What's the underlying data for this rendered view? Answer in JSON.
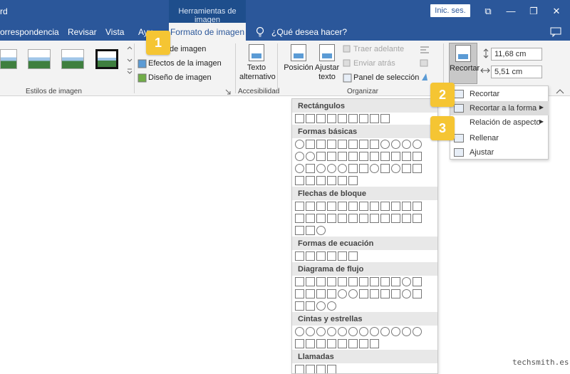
{
  "titlebar": {
    "app_fragment": "rd",
    "context_tab": "Herramientas de imagen",
    "signin": "Inic. ses.",
    "restore_glyph": "⧉",
    "minimize_glyph": "—",
    "maximize_glyph": "❐",
    "close_glyph": "✕"
  },
  "tabs": {
    "correspondencia": "orrespondencia",
    "revisar": "Revisar",
    "vista": "Vista",
    "ayuda": "Ayu",
    "formato": "Formato de imagen",
    "tellme": "¿Qué desea hacer?"
  },
  "ribbon": {
    "estilos_label": "Estilos de imagen",
    "borde": "de imagen",
    "efectos": "Efectos de la imagen",
    "diseno": "Diseño de imagen",
    "texto_alt": [
      "Texto",
      "alternativo"
    ],
    "accesibilidad": "Accesibilidad",
    "posicion": "Posición",
    "ajustar": [
      "Ajustar",
      "texto"
    ],
    "traer": "Traer adelante",
    "enviar": "Enviar atrás",
    "panel": "Panel de selección",
    "organizar": "Organizar",
    "recortar": "Recortar",
    "alto": "11,68 cm",
    "ancho": "5,51 cm"
  },
  "badges": [
    "1",
    "2",
    "3"
  ],
  "crop_menu": {
    "items": [
      "Recortar",
      "Recortar a la forma",
      "Relación de aspecto",
      "Rellenar",
      "Ajustar"
    ],
    "highlighted": "Recortar a la forma"
  },
  "shapes_gallery": {
    "sections": [
      "Rectángulos",
      "Formas básicas",
      "Flechas de bloque",
      "Formas de ecuación",
      "Diagrama de flujo",
      "Cintas y estrellas",
      "Llamadas"
    ]
  },
  "colors": {
    "titlebar": "#2b579a",
    "badge": "#f5c533",
    "ribbon": "#f3f3f3"
  },
  "watermark": "techsmith.es"
}
